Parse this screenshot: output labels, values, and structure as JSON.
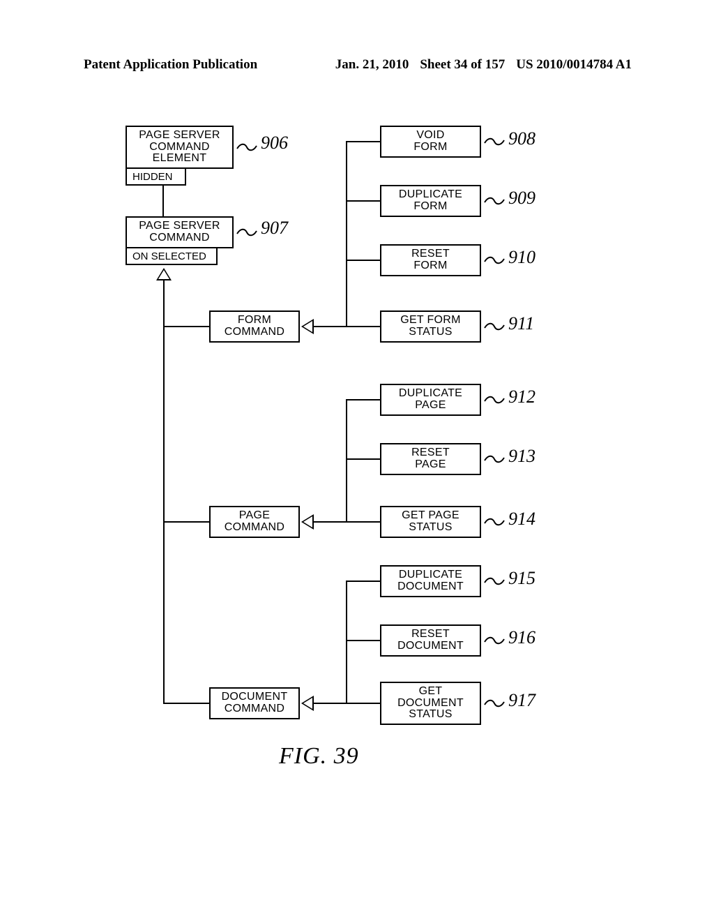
{
  "header": {
    "left": "Patent Application Publication",
    "date": "Jan. 21, 2010",
    "sheet": "Sheet 34 of 157",
    "pubno": "US 2010/0014784 A1"
  },
  "boxes": {
    "b906": {
      "l1": "PAGE SERVER",
      "l2": "COMMAND",
      "l3": "ELEMENT",
      "ref": "906",
      "sub": "HIDDEN"
    },
    "b907": {
      "l1": "PAGE SERVER",
      "l2": "COMMAND",
      "ref": "907",
      "sub": "ON SELECTED"
    },
    "b908": {
      "l1": "VOID",
      "l2": "FORM",
      "ref": "908"
    },
    "b909": {
      "l1": "DUPLICATE",
      "l2": "FORM",
      "ref": "909"
    },
    "b910": {
      "l1": "RESET",
      "l2": "FORM",
      "ref": "910"
    },
    "b911": {
      "l1": "GET FORM",
      "l2": "STATUS",
      "ref": "911"
    },
    "b912": {
      "l1": "DUPLICATE",
      "l2": "PAGE",
      "ref": "912"
    },
    "b913": {
      "l1": "RESET",
      "l2": "PAGE",
      "ref": "913"
    },
    "b914": {
      "l1": "GET PAGE",
      "l2": "STATUS",
      "ref": "914"
    },
    "b915": {
      "l1": "DUPLICATE",
      "l2": "DOCUMENT",
      "ref": "915"
    },
    "b916": {
      "l1": "RESET",
      "l2": "DOCUMENT",
      "ref": "916"
    },
    "b917": {
      "l1": "GET",
      "l2": "DOCUMENT",
      "l3": "STATUS",
      "ref": "917"
    },
    "formcmd": {
      "l1": "FORM",
      "l2": "COMMAND"
    },
    "pagecmd": {
      "l1": "PAGE",
      "l2": "COMMAND"
    },
    "doccmd": {
      "l1": "DOCUMENT",
      "l2": "COMMAND"
    }
  },
  "caption": "FIG. 39"
}
